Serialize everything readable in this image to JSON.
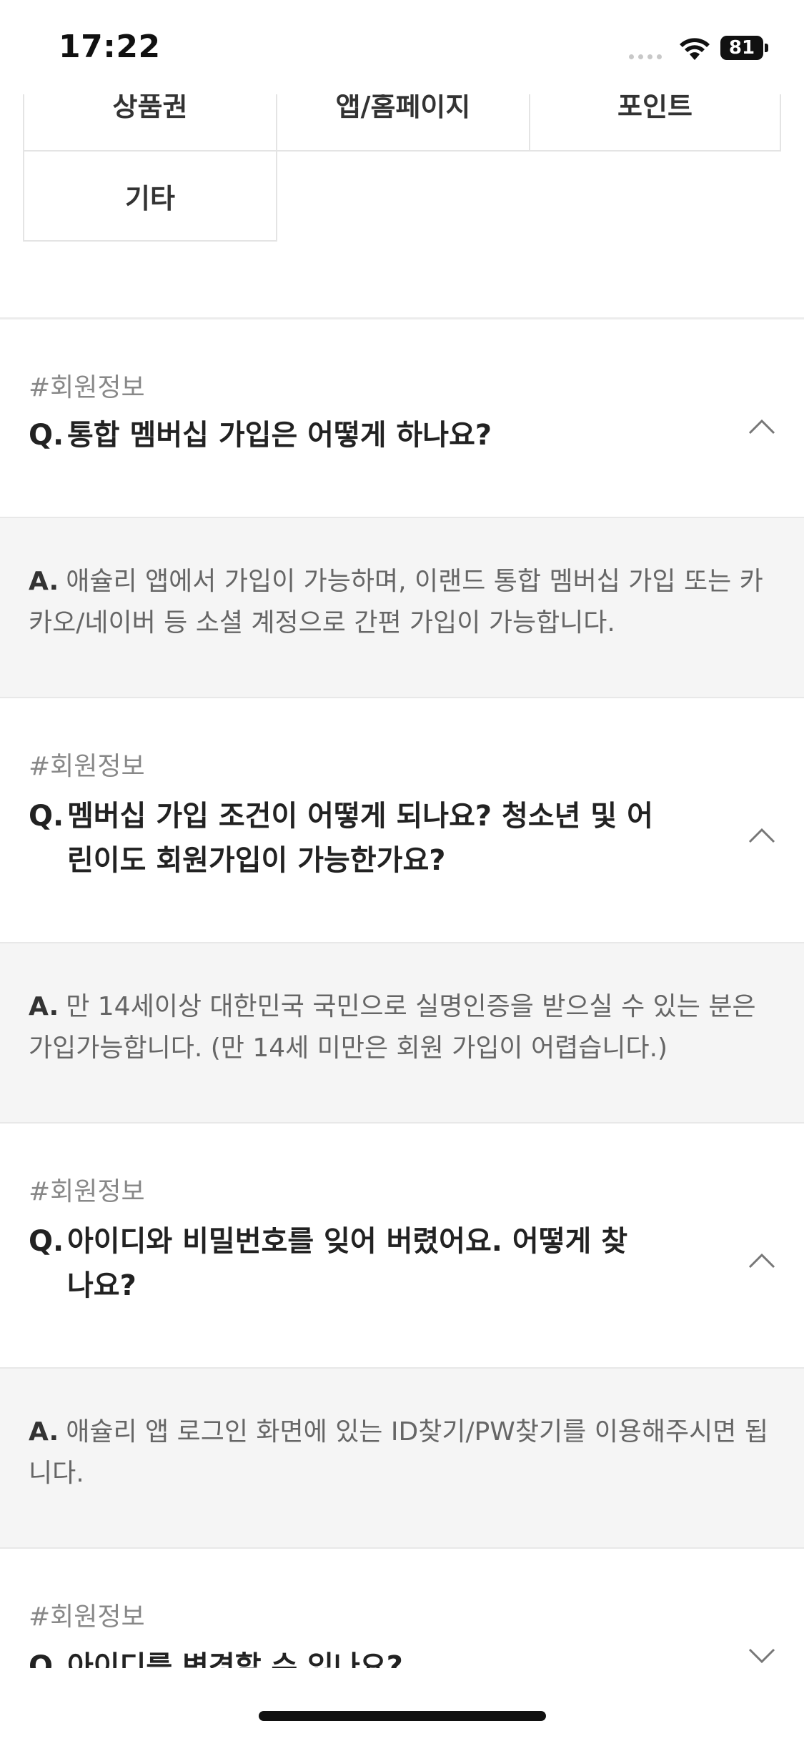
{
  "status": {
    "time": "17:22",
    "battery": "81"
  },
  "categories": [
    "상품권",
    "앱/홈페이지",
    "포인트",
    "기타"
  ],
  "faq": [
    {
      "tag": "#회원정보",
      "q_mark": "Q.",
      "question": "통합 멤버십 가입은 어떻게 하나요?",
      "a_mark": "A.",
      "answer": "애슐리 앱에서 가입이 가능하며, 이랜드 통합 멤버십 가입 또는 카카오/네이버 등 소셜 계정으로 간편 가입이 가능합니다.",
      "expanded": true
    },
    {
      "tag": "#회원정보",
      "q_mark": "Q.",
      "question": "멤버십 가입 조건이 어떻게 되나요? 청소년 및 어린이도 회원가입이 가능한가요?",
      "a_mark": "A.",
      "answer": "만 14세이상 대한민국 국민으로 실명인증을 받으실 수 있는 분은 가입가능합니다. (만 14세 미만은 회원 가입이 어렵습니다.)",
      "expanded": true
    },
    {
      "tag": "#회원정보",
      "q_mark": "Q.",
      "question": "아이디와 비밀번호를 잊어 버렸어요. 어떻게 찾나요?",
      "a_mark": "A.",
      "answer": "애슐리 앱 로그인 화면에 있는 ID찾기/PW찾기를 이용해주시면 됩니다.",
      "expanded": true
    },
    {
      "tag": "#회원정보",
      "q_mark": "Q.",
      "question": "아이디를 변경할 수 있나요?",
      "expanded": false
    }
  ],
  "icons": {
    "expanded": "chevron-up-icon",
    "collapsed": "chevron-down-icon"
  }
}
